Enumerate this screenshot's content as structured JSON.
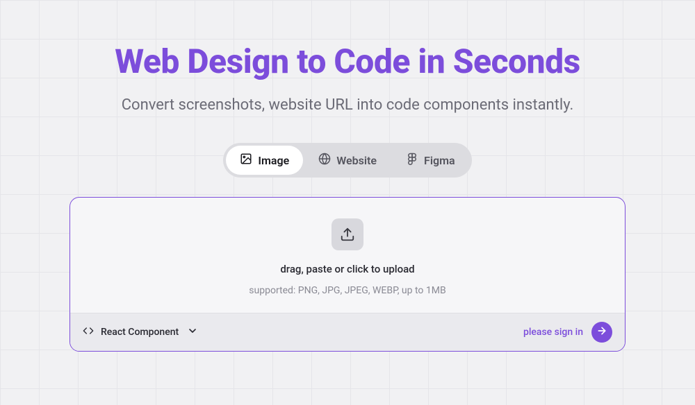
{
  "headline": "Web Design to Code in Seconds",
  "subheadline": "Convert screenshots, website URL into code components instantly.",
  "tabs": {
    "image": "Image",
    "website": "Website",
    "figma": "Figma"
  },
  "dropzone": {
    "primary": "drag, paste or click to upload",
    "secondary": "supported: PNG, JPG, JPEG, WEBP, up to 1MB"
  },
  "output": {
    "selected": "React Component"
  },
  "footer": {
    "signin": "please sign in"
  }
}
